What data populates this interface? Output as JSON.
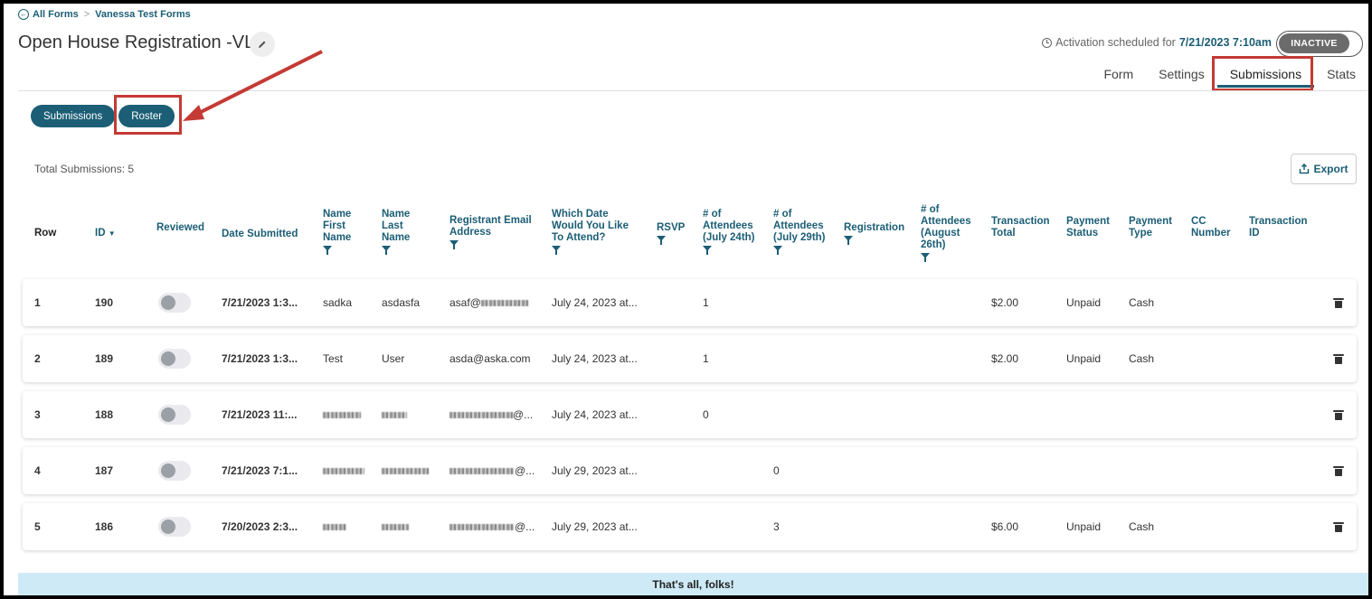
{
  "breadcrumb": {
    "all_forms": "All Forms",
    "separator": ">",
    "current": "Vanessa Test Forms"
  },
  "form_title": "Open House Registration -VL",
  "activation": {
    "prefix": "Activation scheduled for",
    "datetime": "7/21/2023 7:10am"
  },
  "status": "INACTIVE",
  "tabs": [
    "Form",
    "Settings",
    "Submissions",
    "Stats"
  ],
  "active_tab": "Submissions",
  "view_toggle": {
    "submissions": "Submissions",
    "roster": "Roster"
  },
  "total": {
    "label": "Total Submissions:",
    "count": "5"
  },
  "export_label": "Export",
  "headers": {
    "row": "Row",
    "id": "ID",
    "reviewed": "Reviewed",
    "date": "Date Submitted",
    "first": "Name First Name",
    "last": "Name Last Name",
    "email": "Registrant Email Address",
    "which_date": "Which Date Would You Like To Attend?",
    "rsvp": "RSVP",
    "att24": "# of Attendees (July 24th)",
    "att29": "# of Attendees (July 29th)",
    "registration": "Registration",
    "att26": "# of Attendees (August 26th)",
    "txn_total": "Transaction Total",
    "pay_status": "Payment Status",
    "pay_type": "Payment Type",
    "cc": "CC Number",
    "txn_id": "Transaction ID"
  },
  "rows": [
    {
      "row": "1",
      "id": "190",
      "date": "7/21/2023 1:3...",
      "first": "sadka",
      "last": "asdasfa",
      "email": "asaf@",
      "which": "July 24, 2023 at...",
      "att24": "1",
      "att29": "",
      "total": "$2.00",
      "pstatus": "Unpaid",
      "ptype": "Cash"
    },
    {
      "row": "2",
      "id": "189",
      "date": "7/21/2023 1:3...",
      "first": "Test",
      "last": "User",
      "email": "asda@aska.com",
      "which": "July 24, 2023 at...",
      "att24": "1",
      "att29": "",
      "total": "$2.00",
      "pstatus": "Unpaid",
      "ptype": "Cash"
    },
    {
      "row": "3",
      "id": "188",
      "date": "7/21/2023 11:...",
      "first": "",
      "last": "",
      "email": "@...",
      "which": "July 24, 2023 at...",
      "att24": "0",
      "att29": "",
      "total": "",
      "pstatus": "",
      "ptype": ""
    },
    {
      "row": "4",
      "id": "187",
      "date": "7/21/2023 7:1...",
      "first": "",
      "last": "",
      "email": "@...",
      "which": "July 29, 2023 at...",
      "att24": "",
      "att29": "0",
      "total": "",
      "pstatus": "",
      "ptype": ""
    },
    {
      "row": "5",
      "id": "186",
      "date": "7/20/2023 2:3...",
      "first": "",
      "last": "",
      "email": "@...",
      "which": "July 29, 2023 at...",
      "att24": "",
      "att29": "3",
      "total": "$6.00",
      "pstatus": "Unpaid",
      "ptype": "Cash"
    }
  ],
  "footer": "That's all, folks!",
  "colors": {
    "accent": "#1b5e75",
    "highlight": "#c43a34",
    "footer_bg": "#cdeaf6"
  }
}
